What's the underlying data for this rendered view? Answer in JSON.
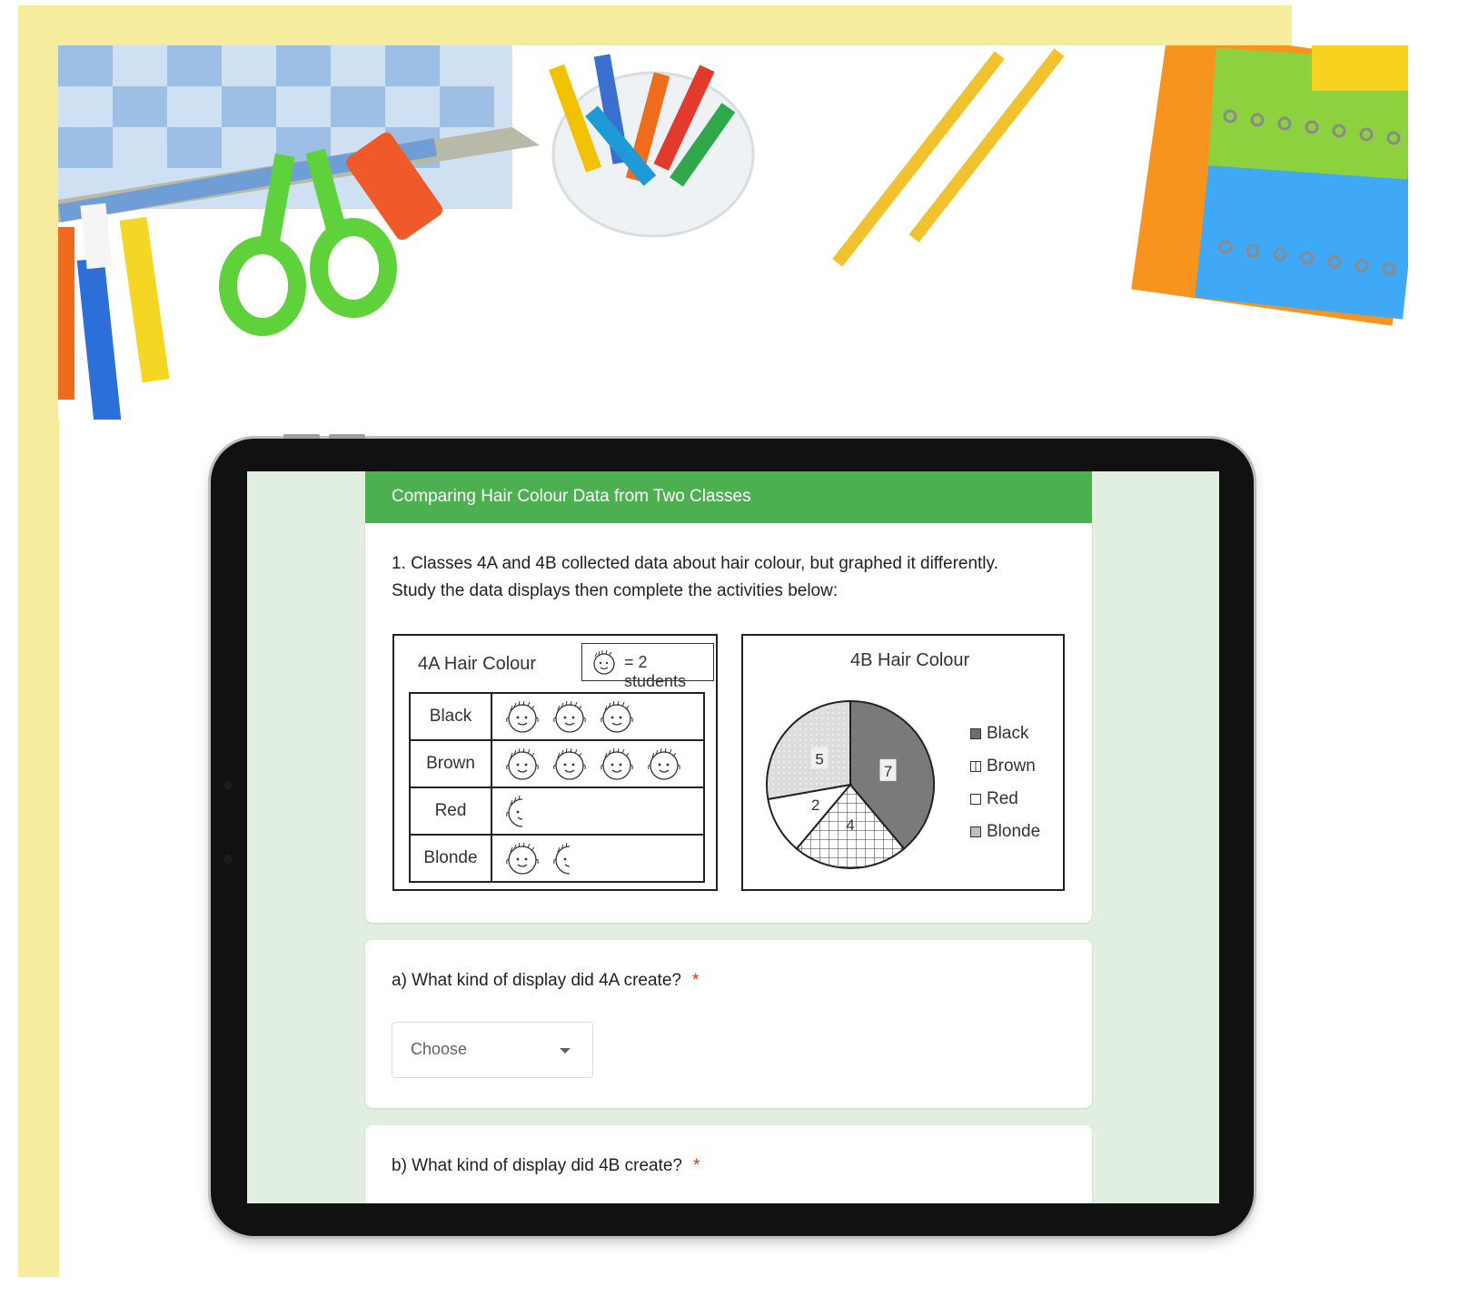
{
  "form": {
    "title": "Comparing Hair Colour Data from Two Classes",
    "intro_line1": "1. Classes 4A and 4B collected data about hair colour, but graphed it differently.",
    "intro_line2": "Study the data displays then complete the activities below:"
  },
  "pictograph": {
    "title": "4A Hair Colour",
    "key": "= 2 students",
    "rows": [
      {
        "label": "Black",
        "symbols": 3
      },
      {
        "label": "Brown",
        "symbols": 4
      },
      {
        "label": "Red",
        "symbols": 0.5
      },
      {
        "label": "Blonde",
        "symbols": 1.5
      }
    ]
  },
  "chart_data": {
    "type": "pie",
    "title": "4B Hair Colour",
    "slices": [
      {
        "label": "Black",
        "value": 7,
        "color": "#7a7a7a"
      },
      {
        "label": "Brown",
        "value": 4,
        "color": "#ffffff"
      },
      {
        "label": "Red",
        "value": 2,
        "color": "#ffffff"
      },
      {
        "label": "Blonde",
        "value": 5,
        "color": "#d8d8d8"
      }
    ],
    "legend": [
      "Black",
      "Brown",
      "Red",
      "Blonde"
    ],
    "legend_position": "right"
  },
  "questions": [
    {
      "label": "a) What kind of display did 4A create?",
      "required_mark": "*",
      "dropdown_value": "Choose"
    },
    {
      "label": "b) What kind of display did 4B create?",
      "required_mark": "*"
    }
  ],
  "colors": {
    "accent": "#4caf50",
    "page_bg": "#e1efe0",
    "frame": "#f5ed9d"
  }
}
